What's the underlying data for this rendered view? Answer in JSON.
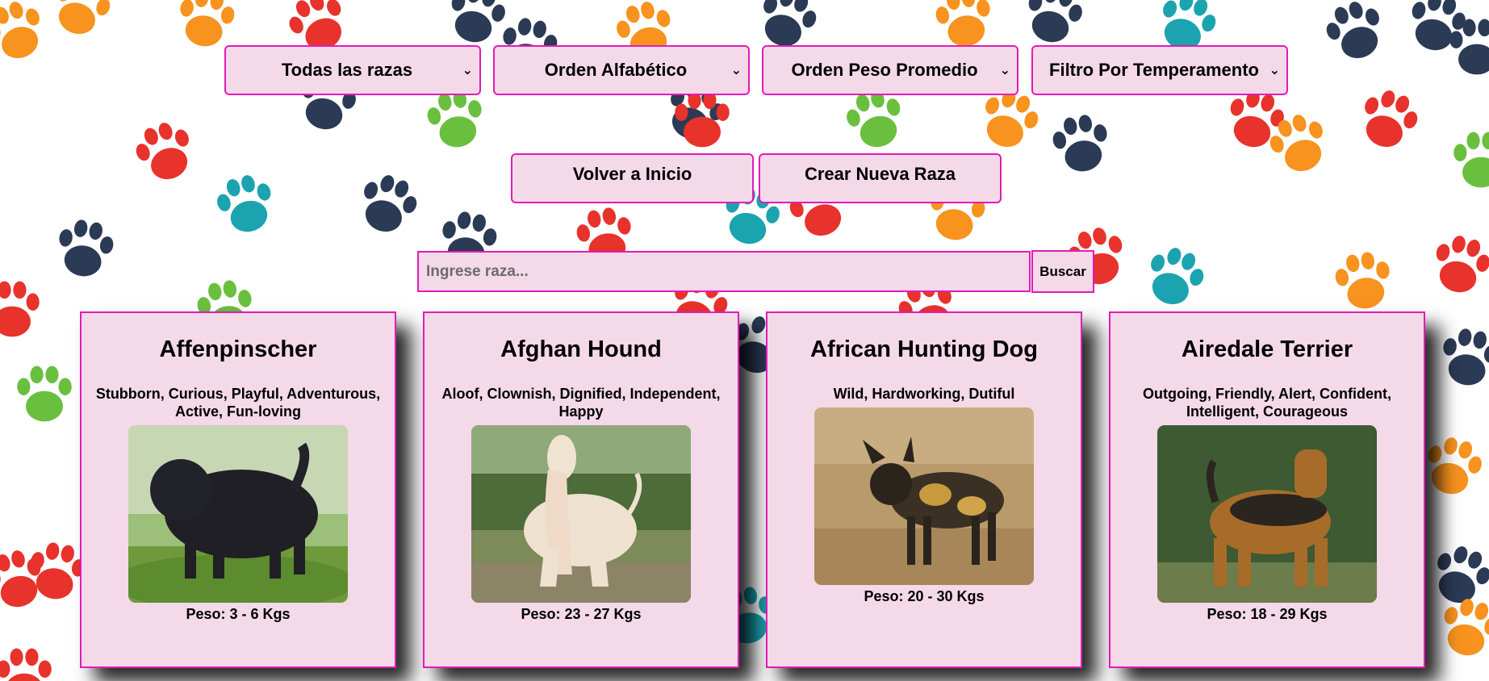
{
  "filters": {
    "razas": "Todas las razas",
    "orden_alfabetico": "Orden Alfabético",
    "orden_peso": "Orden Peso Promedio",
    "temperamento": "Filtro Por Temperamento"
  },
  "nav": {
    "volver": "Volver a Inicio",
    "crear": "Crear Nueva Raza"
  },
  "search": {
    "placeholder": "Ingrese raza...",
    "button": "Buscar"
  },
  "cards": [
    {
      "name": "Affenpinscher",
      "temperament": "Stubborn, Curious, Playful, Adventurous, Active, Fun-loving",
      "weight": "Peso: 3 - 6 Kgs"
    },
    {
      "name": "Afghan Hound",
      "temperament": "Aloof, Clownish, Dignified, Independent, Happy",
      "weight": "Peso: 23 - 27 Kgs"
    },
    {
      "name": "African Hunting Dog",
      "temperament": "Wild, Hardworking, Dutiful",
      "weight": "Peso: 20 - 30 Kgs"
    },
    {
      "name": "Airedale Terrier",
      "temperament": "Outgoing, Friendly, Alert, Confident, Intelligent, Courageous",
      "weight": "Peso: 18 - 29 Kgs"
    }
  ],
  "icons": {
    "background": "paw-print-pattern",
    "select_arrow": "chevron-down-icon"
  },
  "colors": {
    "panel": "#f4d9e8",
    "border": "#e21bb6",
    "paws": [
      "#f7931e",
      "#2b3a55",
      "#e8322c",
      "#1ba3b0",
      "#6abf3f"
    ]
  }
}
